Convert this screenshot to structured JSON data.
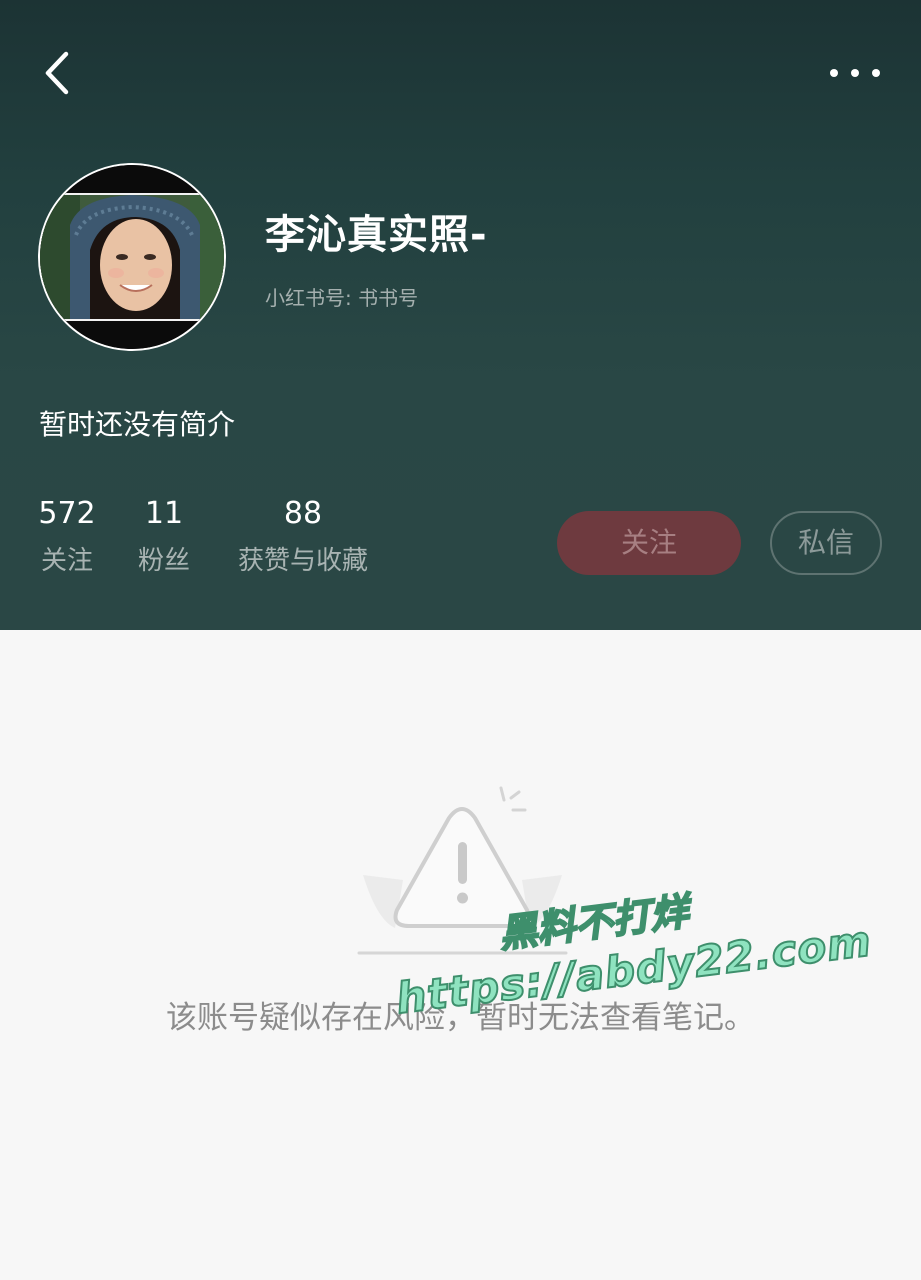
{
  "profile": {
    "name": "李沁真实照-",
    "red_id_label": "小红书号: 书书号",
    "bio": "暂时还没有简介"
  },
  "stats": [
    {
      "value": "572",
      "label": "关注"
    },
    {
      "value": "11",
      "label": "粉丝"
    },
    {
      "value": "88",
      "label": "获赞与收藏"
    }
  ],
  "actions": {
    "follow_label": "关注",
    "message_label": "私信"
  },
  "notice": {
    "text": "该账号疑似存在风险，暂时无法查看笔记。"
  },
  "watermark": {
    "line1": "黑料不打烊",
    "line2": "https://abdy22.com"
  },
  "icons": {
    "back": "chevron-left-icon",
    "more": "more-dots-icon",
    "warning": "warning-triangle-icon"
  },
  "colors": {
    "header_bg": "#24403f",
    "follow_bg": "#6e3a3f",
    "page_bg": "#f7f7f7"
  }
}
